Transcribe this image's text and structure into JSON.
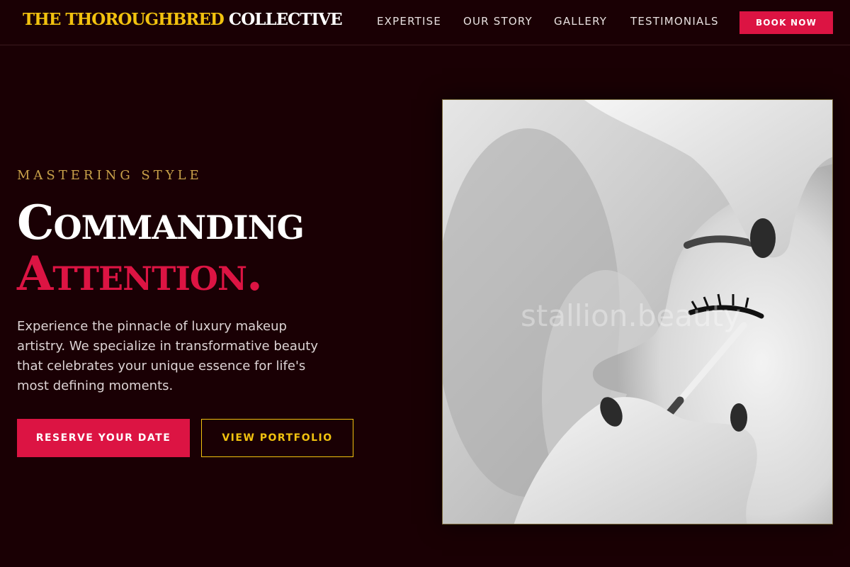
{
  "brand": {
    "name_part1": "THE THOROUGHBRED",
    "name_part2": "COLLECTIVE"
  },
  "nav": {
    "items": [
      {
        "label": "EXPERTISE"
      },
      {
        "label": "OUR STORY"
      },
      {
        "label": "GALLERY"
      },
      {
        "label": "TESTIMONIALS"
      }
    ],
    "cta_label": "BOOK NOW"
  },
  "hero": {
    "eyebrow": "MASTERING STYLE",
    "headline_line1": "Commanding",
    "headline_line2": "Attention.",
    "description": "Experience the pinnacle of luxury makeup artistry. We specialize in transformative beauty that celebrates your unique essence for life's most defining moments.",
    "primary_button": "RESERVE YOUR DATE",
    "secondary_button": "VIEW PORTFOLIO",
    "image_watermark": "stallion.beauty"
  },
  "colors": {
    "background": "#1a0004",
    "accent_red": "#dc1443",
    "accent_gold": "#f2c20f",
    "eyebrow_gold": "#c9a14a"
  }
}
